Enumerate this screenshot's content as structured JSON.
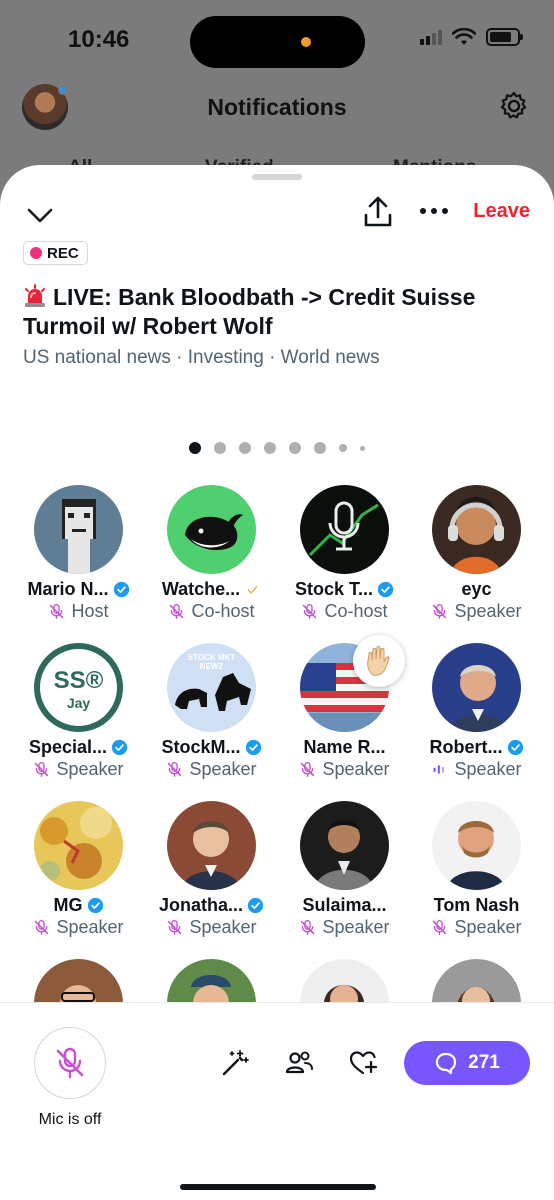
{
  "status_bar": {
    "time": "10:46"
  },
  "background": {
    "title": "Notifications",
    "tabs": [
      "All",
      "Verified",
      "Mentions"
    ]
  },
  "space": {
    "leave_label": "Leave",
    "rec_label": "REC",
    "title": "LIVE: Bank Bloodbath -> Credit Suisse Turmoil w/ Robert Wolf",
    "topics": "US national news · Investing · World news",
    "page_count": 8,
    "active_page": 1
  },
  "participants": [
    {
      "name": "Mario N...",
      "role": "Host",
      "verified": "blue",
      "mic": "muted"
    },
    {
      "name": "Watche...",
      "role": "Co-host",
      "verified": "gold",
      "mic": "muted"
    },
    {
      "name": "Stock T...",
      "role": "Co-host",
      "verified": "blue",
      "mic": "muted"
    },
    {
      "name": "eyc",
      "role": "Speaker",
      "verified": "none",
      "mic": "muted"
    },
    {
      "name": "Special...",
      "role": "Speaker",
      "verified": "blue",
      "mic": "muted",
      "avatar_text_1": "SS®",
      "avatar_text_2": "Jay"
    },
    {
      "name": "StockM...",
      "role": "Speaker",
      "verified": "blue",
      "mic": "muted",
      "avatar_text_1": "STOCK MKT NEWZ"
    },
    {
      "name": "Name R...",
      "role": "Speaker",
      "verified": "none",
      "mic": "muted",
      "hand_raised": true
    },
    {
      "name": "Robert...",
      "role": "Speaker",
      "verified": "blue",
      "mic": "speaking"
    },
    {
      "name": "MG",
      "role": "Speaker",
      "verified": "blue",
      "mic": "muted"
    },
    {
      "name": "Jonatha...",
      "role": "Speaker",
      "verified": "blue",
      "mic": "muted"
    },
    {
      "name": "Sulaima...",
      "role": "Speaker",
      "verified": "none",
      "mic": "muted"
    },
    {
      "name": "Tom Nash",
      "role": "Speaker",
      "verified": "none",
      "mic": "muted"
    }
  ],
  "bottom_bar": {
    "mic_label": "Mic is off",
    "comment_count": "271"
  },
  "colors": {
    "accent": "#7856ff",
    "leave": "#f4212e",
    "rec": "#f0317c",
    "verified_blue": "#1d9bf0",
    "mic_muted": "#c74fd6"
  }
}
